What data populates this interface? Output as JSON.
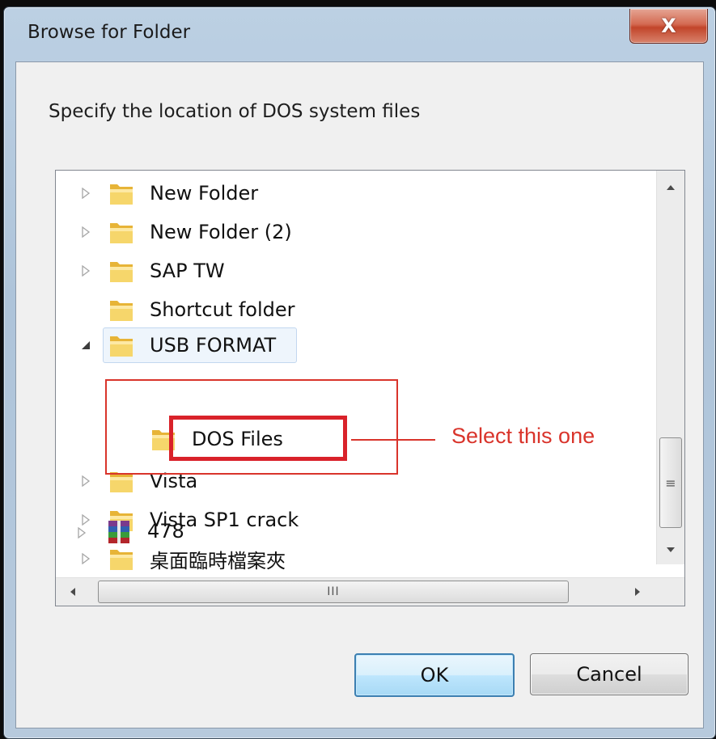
{
  "window": {
    "title": "Browse for Folder",
    "close_symbol": "X"
  },
  "prompt": "Specify the location of DOS system files",
  "tree": {
    "items": [
      {
        "label": "New Folder",
        "icon": "folder-icon",
        "expander": "collapsed"
      },
      {
        "label": "New Folder (2)",
        "icon": "folder-icon",
        "expander": "collapsed"
      },
      {
        "label": "SAP TW",
        "icon": "folder-icon",
        "expander": "collapsed"
      },
      {
        "label": "Shortcut folder",
        "icon": "folder-icon",
        "expander": "none"
      },
      {
        "label": "USB FORMAT",
        "icon": "folder-icon",
        "expander": "expanded"
      },
      {
        "label": "DOS Files",
        "icon": "folder-icon",
        "expander": "none"
      },
      {
        "label": "Vista",
        "icon": "folder-icon",
        "expander": "collapsed"
      },
      {
        "label": "Vista SP1 crack",
        "icon": "folder-icon",
        "expander": "collapsed"
      },
      {
        "label": "桌面臨時檔案夾",
        "icon": "folder-icon",
        "expander": "collapsed"
      },
      {
        "label": "478",
        "icon": "archive-icon",
        "expander": "collapsed"
      }
    ],
    "selected_hover": "USB FORMAT"
  },
  "annotation": {
    "text": "Select this one",
    "color": "#d9342b"
  },
  "scrollbar": {
    "vertical_grip": "≡",
    "horizontal_grip": "III"
  },
  "buttons": {
    "ok_label": "OK",
    "cancel_label": "Cancel"
  }
}
